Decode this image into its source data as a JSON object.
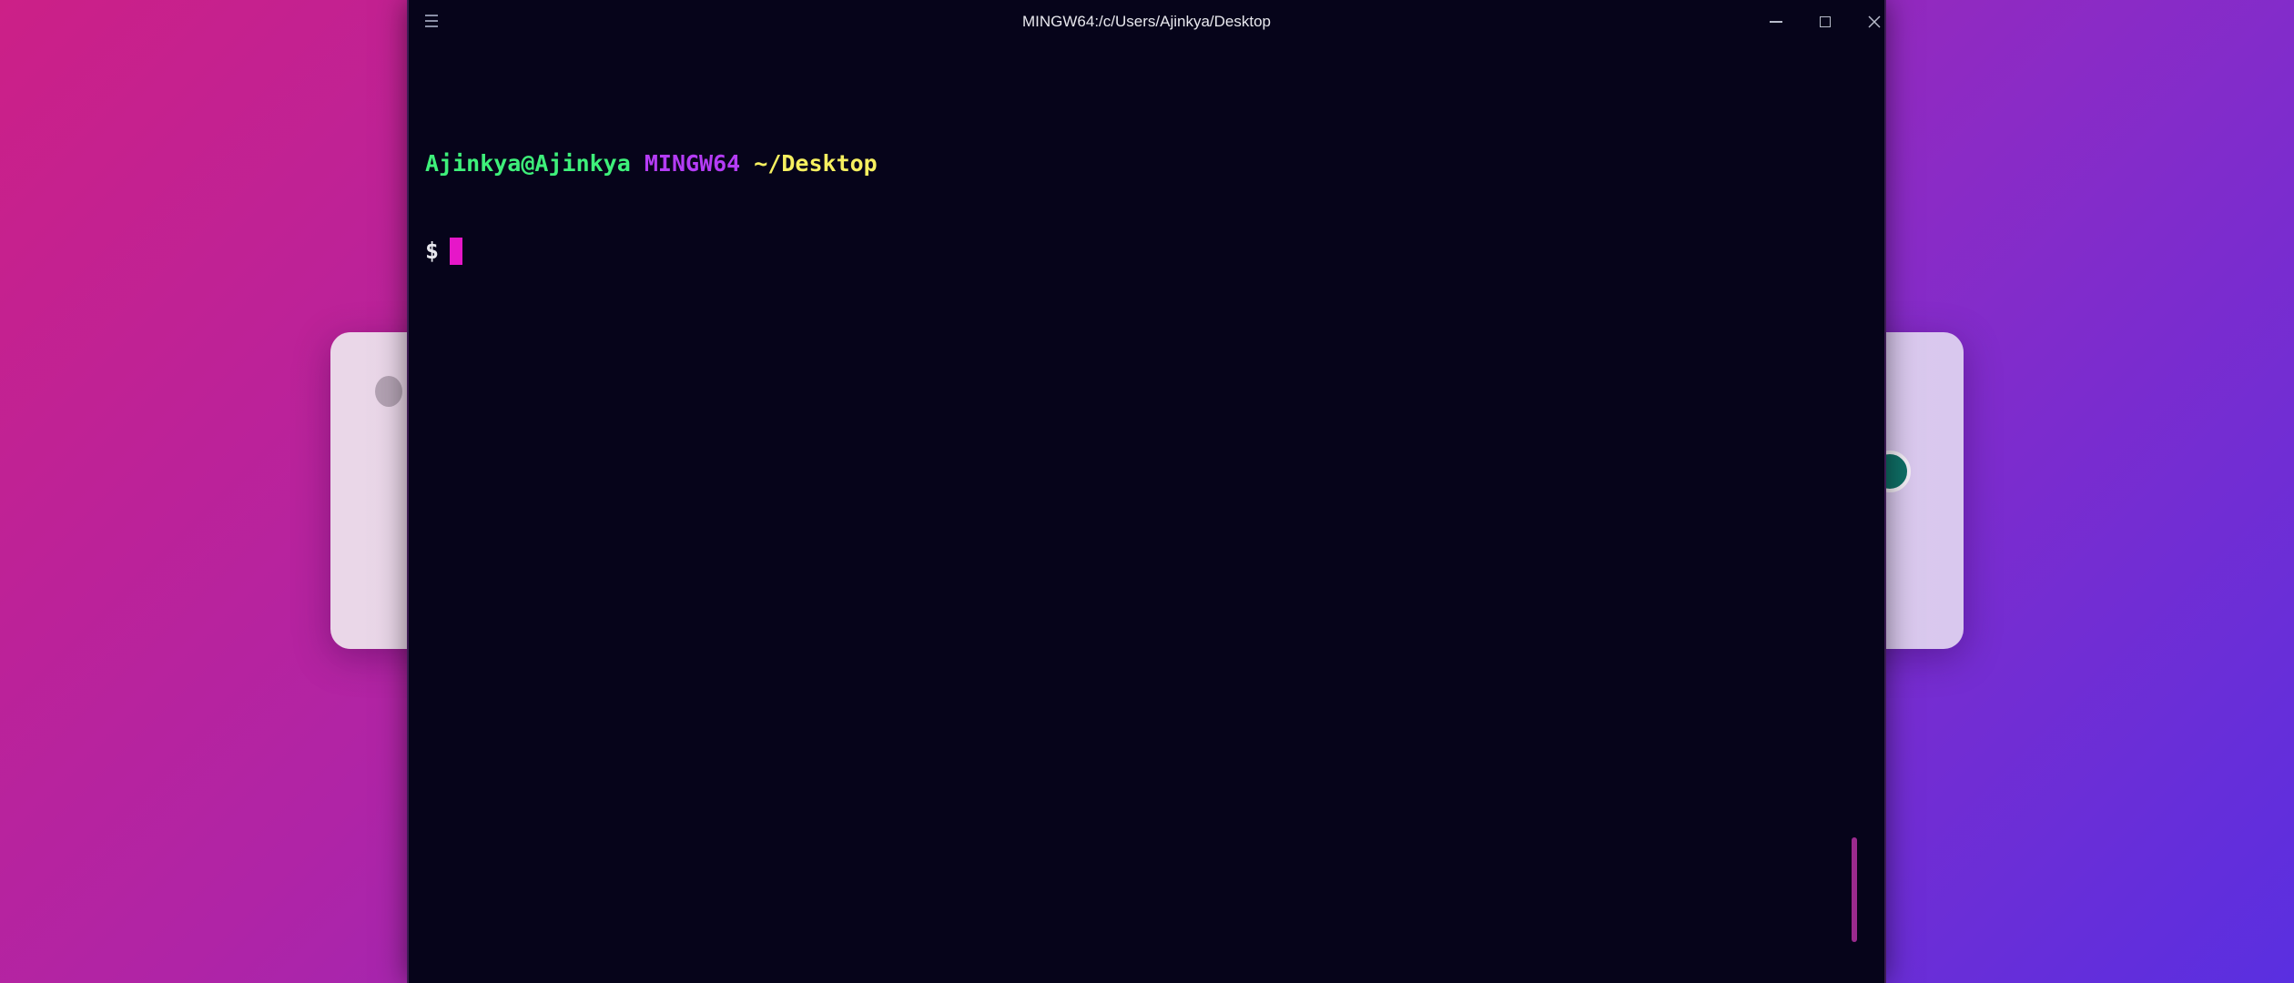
{
  "window": {
    "title": "MINGW64:/c/Users/Ajinkya/Desktop"
  },
  "terminal": {
    "user_host": "Ajinkya@Ajinkya",
    "system": "MINGW64",
    "path": "~/Desktop",
    "prompt_symbol": "$"
  },
  "icons": {
    "menu": "hamburger-menu-icon",
    "minimize": "minimize-icon",
    "maximize": "maximize-icon",
    "close": "close-icon"
  },
  "colors": {
    "terminal_bg": "#06041a",
    "user_host": "#3ef07a",
    "system": "#b43cf5",
    "path": "#f6f060",
    "cursor": "#e617c8"
  }
}
